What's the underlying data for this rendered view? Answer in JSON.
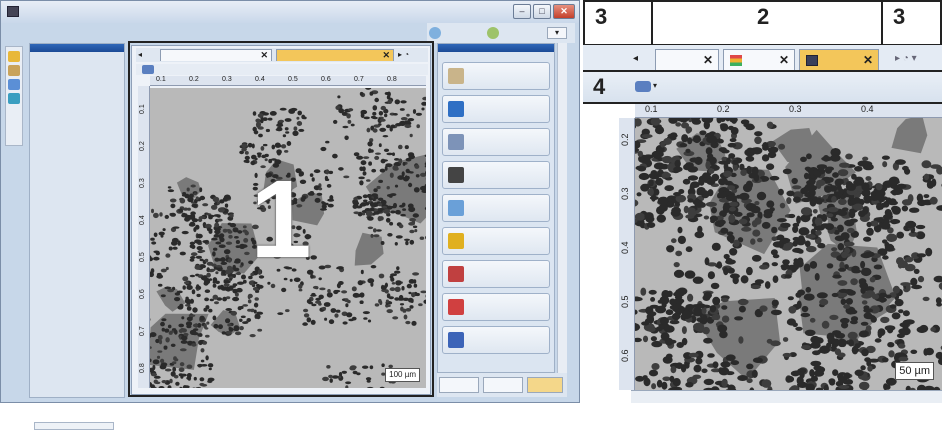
{
  "callouts": {
    "c1": "1",
    "c2": "2",
    "c3a": "3",
    "c3b": "3",
    "c4": "4"
  },
  "left_window": {
    "ruler_h": [
      "0.1",
      "0.2",
      "0.3",
      "0.4",
      "0.5",
      "0.6",
      "0.7",
      "0.8"
    ],
    "ruler_v": [
      "0.1",
      "0.2",
      "0.3",
      "0.4",
      "0.5",
      "0.6",
      "0.7",
      "0.8"
    ],
    "scale_bar": "100 µm",
    "toolbar_buttons": [
      {
        "icon": "measure-icon",
        "color": "#c9b48a"
      },
      {
        "icon": "color-blob-icon",
        "color": "#2f6fc4"
      },
      {
        "icon": "wrench-icon",
        "color": "#7d93b8"
      },
      {
        "icon": "grain-icon",
        "color": "#444444"
      },
      {
        "icon": "zoom-icon",
        "color": "#6aa0d8"
      },
      {
        "icon": "split-icon",
        "color": "#e0b020"
      },
      {
        "icon": "chart-icon",
        "color": "#c04040"
      },
      {
        "icon": "particle-icon",
        "color": "#d04040"
      },
      {
        "icon": "histogram-icon",
        "color": "#3c64b8"
      }
    ]
  },
  "zoom_panel": {
    "ruler_h": [
      "0.1",
      "0.2",
      "0.3",
      "0.4"
    ],
    "ruler_v": [
      "0.2",
      "0.3",
      "0.4",
      "0.5",
      "0.6"
    ],
    "scale_bar": "50 µm"
  }
}
